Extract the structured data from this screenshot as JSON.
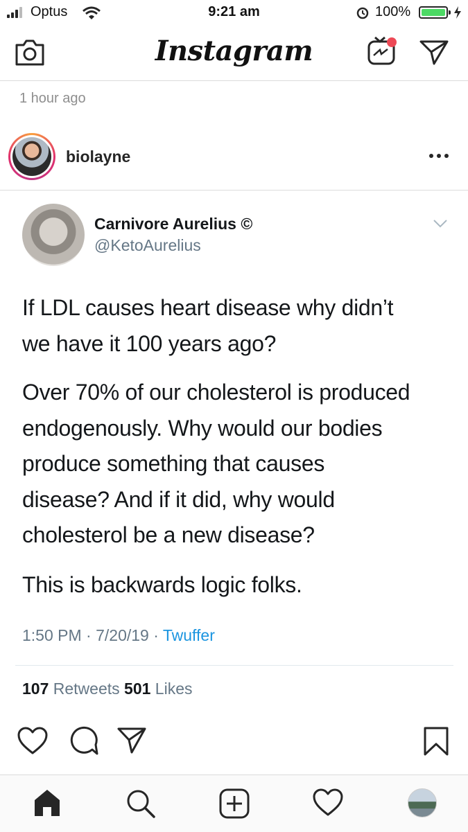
{
  "status_bar": {
    "carrier": "Optus",
    "time": "9:21 am",
    "battery": "100%"
  },
  "header": {
    "logo": "Instagram"
  },
  "post": {
    "time_ago": "1 hour ago",
    "username": "biolayne"
  },
  "tweet": {
    "name": "Carnivore Aurelius ©",
    "handle": "@KetoAurelius",
    "paragraphs": [
      [
        "If LDL causes heart disease why didn’t",
        "we have it 100 years ago?"
      ],
      [
        "Over 70% of our cholesterol is produced",
        "endogenously. Why would our bodies",
        "produce something that causes",
        "disease? And if it did, why would",
        "cholesterol be a new disease?"
      ],
      [
        "This is backwards logic folks."
      ]
    ],
    "timestamp": "1:50 PM · 7/20/19 · ",
    "source": "Twuffer",
    "retweets_count": "107",
    "retweets_label": " Retweets ",
    "likes_count": "501",
    "likes_label": " Likes"
  },
  "icons": {
    "camera": "camera-icon",
    "igtv": "igtv-icon",
    "direct": "paper-plane-icon",
    "like": "heart-icon",
    "comment": "comment-icon",
    "share": "paper-plane-icon",
    "save": "bookmark-icon",
    "home": "home-icon",
    "search": "search-icon",
    "add": "plus-square-icon",
    "activity": "heart-icon",
    "profile": "avatar"
  },
  "colors": {
    "link": "#1b95e0",
    "muted": "#657786",
    "battery": "#4cd964",
    "notification": "#ed4956"
  }
}
